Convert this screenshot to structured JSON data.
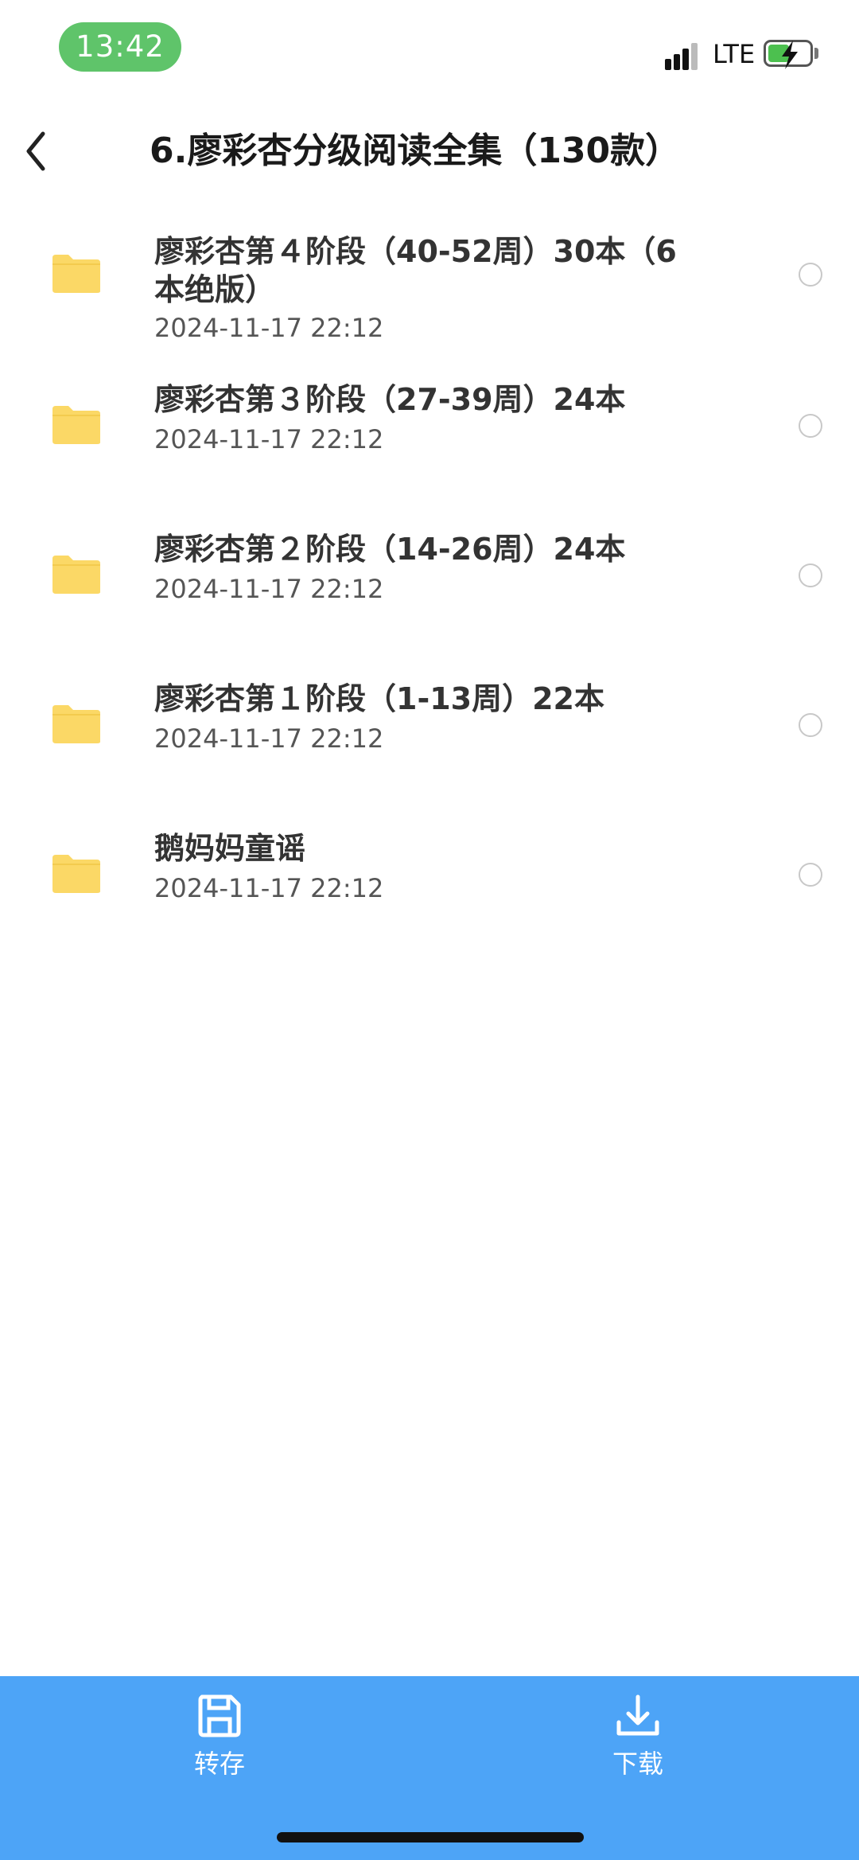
{
  "status_bar": {
    "time": "13:42",
    "network": "LTE",
    "colors": {
      "time_pill": "#5fc46a",
      "battery_fill": "#4cc04f"
    }
  },
  "nav": {
    "back_icon": "chevron-left-icon",
    "title": "6.廖彩杏分级阅读全集（130款）"
  },
  "files": [
    {
      "name": "廖彩杏第４阶段（40-52周）30本（6本绝版）",
      "date": "2024-11-17 22:12",
      "icon": "folder-icon"
    },
    {
      "name": "廖彩杏第３阶段（27-39周）24本",
      "date": "2024-11-17 22:12",
      "icon": "folder-icon"
    },
    {
      "name": "廖彩杏第２阶段（14-26周）24本",
      "date": "2024-11-17 22:12",
      "icon": "folder-icon"
    },
    {
      "name": "廖彩杏第１阶段（1-13周）22本",
      "date": "2024-11-17 22:12",
      "icon": "folder-icon"
    },
    {
      "name": "鹅妈妈童谣",
      "date": "2024-11-17 22:12",
      "icon": "folder-icon"
    }
  ],
  "toolbar": {
    "save_label": "转存",
    "save_icon": "save-disk-icon",
    "download_label": "下载",
    "download_icon": "download-icon",
    "background": "#4da4f7"
  },
  "colors": {
    "folder": "#fbd866",
    "accent": "#4da4f7"
  }
}
